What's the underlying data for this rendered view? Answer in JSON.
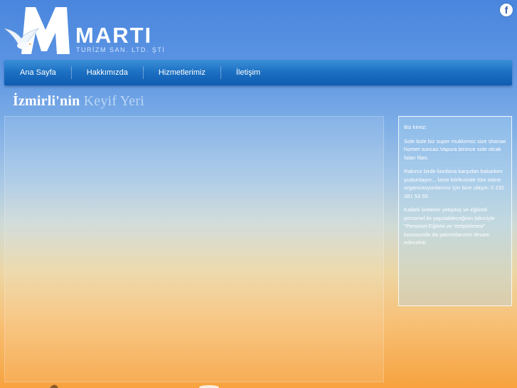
{
  "brand": {
    "name": "MARTI",
    "subtitle": "TURİZM SAN. LTD. ŞTİ",
    "logo_icon": "seagull-m-logo-icon"
  },
  "social": {
    "facebook_label": "f"
  },
  "nav": {
    "items": [
      {
        "label": "Ana Sayfa"
      },
      {
        "label": "Hakkımızda"
      },
      {
        "label": "Hizmetlerimiz"
      },
      {
        "label": "İletişim"
      }
    ]
  },
  "heading": {
    "part1": "İzmirli'nin",
    "part2": "Keyif Yeri"
  },
  "sidebar": {
    "paragraphs": [
      "Biz kimiz;",
      "Sole bole biz super mukkemiz size shanae hizmet suncaz.Vapura binince sole olcak falan filan.",
      "Rakınız birde kordona karşıdan bakarken yudumlayın... İzmir körfezinde tüm tekne organizasyonlarınız için bize ulaşın; 0 232 381 53 55",
      "Kaliteli üretimin yetişmiş ve eğitimli personel ile yapılabileceğinin bilinciyle \"Personel Eğitimi ve Yetiştirilmesi\" konusunda da yatırımlarımız devam edecektir."
    ]
  },
  "colors": {
    "nav_top": "#3b8fd9",
    "nav_bottom": "#0f5db2",
    "sky_top": "#4a86de",
    "sunset_bottom": "#f7a23e",
    "heading_accent": "#b9d7f3"
  }
}
